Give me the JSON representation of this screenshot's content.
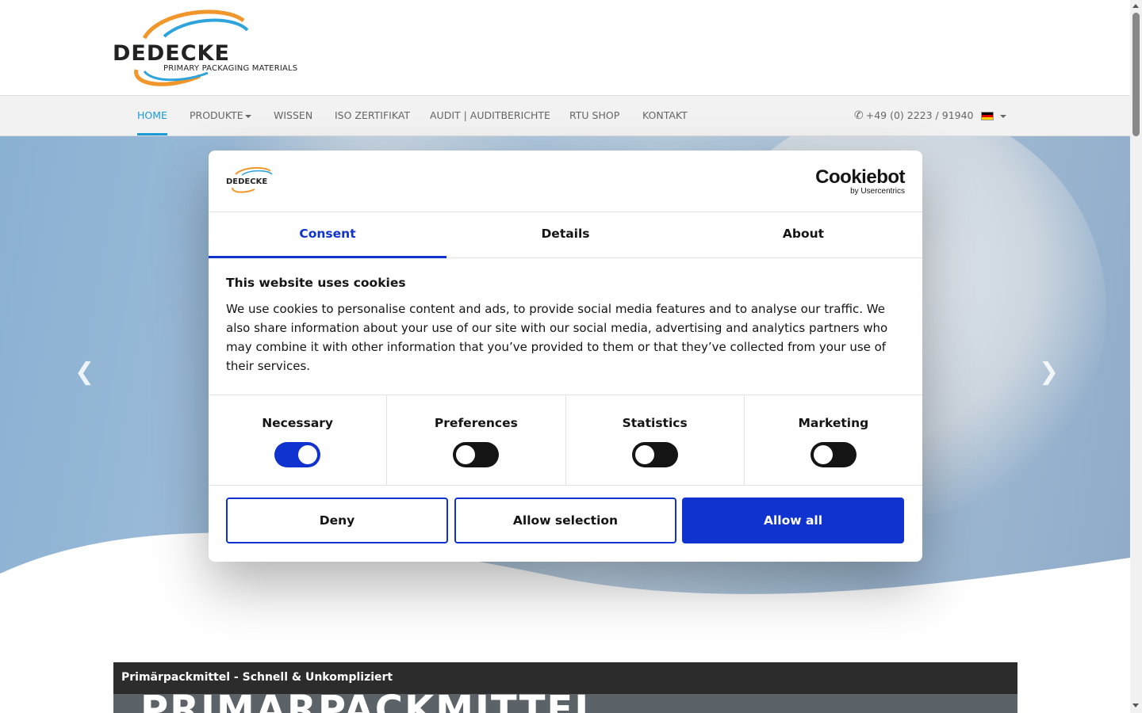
{
  "header": {
    "logo_text": "DEDECKE",
    "logo_subtitle": "PRIMARY PACKAGING MATERIALS"
  },
  "nav": {
    "items": [
      {
        "label": "HOME",
        "active": true
      },
      {
        "label": "PRODUKTE",
        "dropdown": true
      },
      {
        "label": "WISSEN"
      },
      {
        "label": "ISO ZERTIFIKAT"
      },
      {
        "label": "AUDIT | AUDITBERICHTE"
      },
      {
        "label": "RTU SHOP"
      },
      {
        "label": "KONTAKT"
      }
    ],
    "phone": "+49 (0) 2223 / 91940",
    "phone_icon": "phone-icon",
    "language_flag": "german-flag-icon"
  },
  "hero": {
    "prev_icon": "chevron-left-icon",
    "next_icon": "chevron-right-icon"
  },
  "video": {
    "title": "Primärpackmittel - Schnell & Unkompliziert",
    "overlay_text": "PRIMÄRPACKMITTEL"
  },
  "cookie": {
    "brand_name": "Cookiebot",
    "brand_sub": "by Usercentrics",
    "tabs": [
      {
        "label": "Consent",
        "active": true
      },
      {
        "label": "Details"
      },
      {
        "label": "About"
      }
    ],
    "title": "This website uses cookies",
    "text": "We use cookies to personalise content and ads, to provide social media features and to analyse our traffic. We also share information about your use of our site with our social media, advertising and analytics partners who may combine it with other information that you’ve provided to them or that they’ve collected from your use of their services.",
    "levels": [
      {
        "label": "Necessary",
        "checked": true
      },
      {
        "label": "Preferences",
        "checked": false
      },
      {
        "label": "Statistics",
        "checked": false
      },
      {
        "label": "Marketing",
        "checked": false
      }
    ],
    "buttons": {
      "deny": "Deny",
      "allow_selection": "Allow selection",
      "allow_all": "Allow all"
    }
  },
  "colors": {
    "accent": "#1a9bd7",
    "cookie_primary": "#1032cf",
    "logo_orange": "#f0962a",
    "logo_blue": "#2ea3dc"
  }
}
